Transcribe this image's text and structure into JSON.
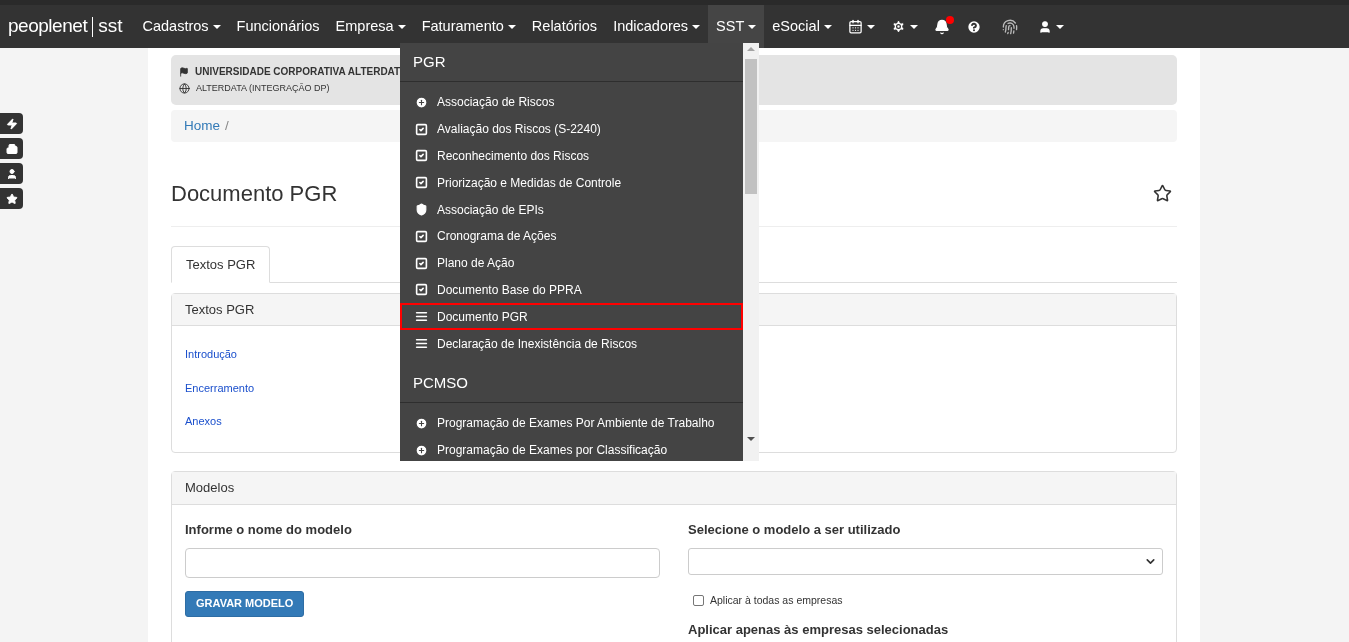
{
  "navbar": {
    "brand": "peoplenet",
    "brand_suffix": "sst",
    "items": [
      {
        "label": "Cadastros",
        "dropdown": true,
        "selected": false
      },
      {
        "label": "Funcionários",
        "dropdown": false,
        "selected": false
      },
      {
        "label": "Empresa",
        "dropdown": true,
        "selected": false
      },
      {
        "label": "Faturamento",
        "dropdown": true,
        "selected": false
      },
      {
        "label": "Relatórios",
        "dropdown": false,
        "selected": false
      },
      {
        "label": "Indicadores",
        "dropdown": true,
        "selected": false
      },
      {
        "label": "SST",
        "dropdown": true,
        "selected": true
      },
      {
        "label": "eSocial",
        "dropdown": true,
        "selected": false
      }
    ]
  },
  "sst_menu": {
    "sections": [
      {
        "title": "PGR",
        "items": [
          {
            "label": "Associação de Riscos",
            "kind": "plus",
            "selected": false
          },
          {
            "label": "Avaliação dos Riscos (S-2240)",
            "kind": "check",
            "selected": false
          },
          {
            "label": "Reconhecimento dos Riscos",
            "kind": "check",
            "selected": false
          },
          {
            "label": "Priorização e Medidas de Controle",
            "kind": "check",
            "selected": false
          },
          {
            "label": "Associação de EPIs",
            "kind": "shield",
            "selected": false
          },
          {
            "label": "Cronograma de Ações",
            "kind": "check",
            "selected": false
          },
          {
            "label": "Plano de Ação",
            "kind": "check",
            "selected": false
          },
          {
            "label": "Documento Base do PPRA",
            "kind": "check",
            "selected": false
          },
          {
            "label": "Documento PGR",
            "kind": "list",
            "selected": true
          },
          {
            "label": "Declaração de Inexistência de Riscos",
            "kind": "list",
            "selected": false
          }
        ]
      },
      {
        "title": "PCMSO",
        "items": [
          {
            "label": "Programação de Exames Por Ambiente de Trabalho",
            "kind": "plus",
            "selected": false
          },
          {
            "label": "Programação de Exames por Classificação",
            "kind": "plus",
            "selected": false
          }
        ]
      }
    ]
  },
  "company_card": {
    "name": "UNIVERSIDADE CORPORATIVA ALTERDAT",
    "unit": "ALTERDATA (INTEGRAÇÃO DP)"
  },
  "breadcrumb": {
    "items": [
      "Home"
    ],
    "separator": "/"
  },
  "page_title": "Documento PGR",
  "tabs": [
    {
      "label": "Textos PGR",
      "selected": true
    }
  ],
  "texts_panel": {
    "title": "Textos PGR",
    "links": [
      "Introdução",
      "Encerramento",
      "Anexos"
    ]
  },
  "models_panel": {
    "title": "Modelos",
    "name_label": "Informe o nome do modelo",
    "save_button": "GRAVAR MODELO",
    "select_label": "Selecione o modelo a ser utilizado",
    "apply_all": {
      "label": "Aplicar à todas as empresas",
      "checked": false
    },
    "apply_selected_label": "Aplicar apenas às empresas selecionadas"
  }
}
